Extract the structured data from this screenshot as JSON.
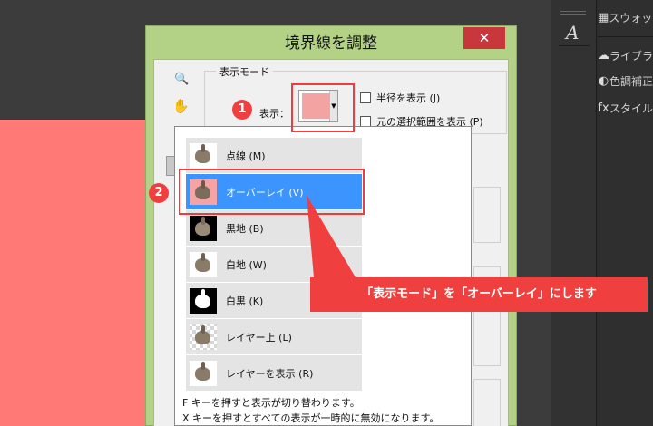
{
  "dialog": {
    "title": "境界線を調整",
    "close_glyph": "✕",
    "display_mode_legend": "表示モード",
    "view_label": "表示：",
    "checkbox_radius": "半径を表示 (J)",
    "checkbox_original": "元の選択範囲を表示 (P)"
  },
  "dropdown": {
    "options": [
      {
        "label": "点線 (M)",
        "thumb": "plain"
      },
      {
        "label": "オーバーレイ (V)",
        "thumb": "overlay"
      },
      {
        "label": "黒地 (B)",
        "thumb": "black"
      },
      {
        "label": "白地 (W)",
        "thumb": "white"
      },
      {
        "label": "白黒 (K)",
        "thumb": "bw"
      },
      {
        "label": "レイヤー上 (L)",
        "thumb": "checker"
      },
      {
        "label": "レイヤーを表示 (R)",
        "thumb": "plain"
      }
    ],
    "selected": "オーバーレイ (V)",
    "hint_f": "F キーを押すと表示が切り替わります。",
    "hint_x": "X キーを押すとすべての表示が一時的に無効になります。"
  },
  "right_panel": {
    "items": [
      {
        "icon": "swatches-icon",
        "label": "スウォッチ"
      },
      {
        "icon": "libraries-icon",
        "label": "ライブラリ"
      },
      {
        "icon": "adjustments-icon",
        "label": "色調補正"
      },
      {
        "icon": "styles-icon",
        "label": "スタイル"
      }
    ]
  },
  "annotations": {
    "step1": "1",
    "step2": "2",
    "callout": "「表示モード」を「オーバーレイ」にします"
  },
  "colors": {
    "dialog_title_bg": "#b4d286",
    "selected_option": "#3b94ff",
    "annotation_red": "#ef3f3f",
    "canvas_pink": "#ff7a77"
  }
}
